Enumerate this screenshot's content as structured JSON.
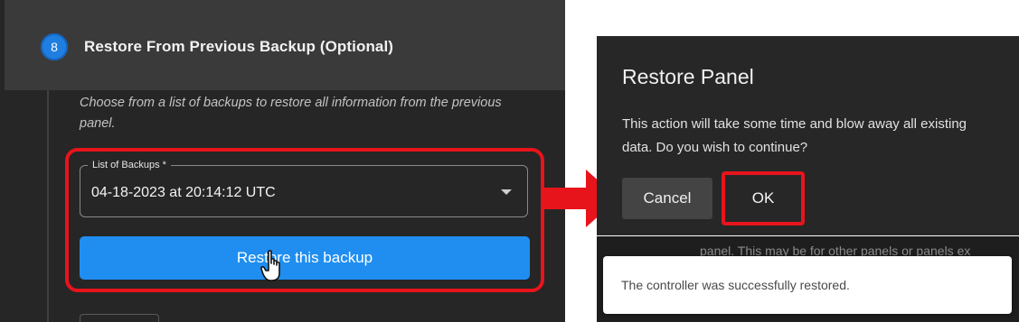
{
  "step": {
    "number": "8",
    "title": "Restore From Previous Backup (Optional)",
    "description": "Choose from a list of backups to restore all information from the previous panel."
  },
  "backup_select": {
    "label": "List of Backups *",
    "value": "04-18-2023 at 20:14:12 UTC"
  },
  "restore_button": {
    "label": "Restore this backup"
  },
  "dialog": {
    "title": "Restore Panel",
    "message": "This action will take some time and blow away all existing data. Do you wish to continue?",
    "cancel_label": "Cancel",
    "ok_label": "OK"
  },
  "background_text": "panel. This may be for other panels or panels ex",
  "toast": {
    "message": "The controller was successfully restored."
  },
  "colors": {
    "accent_blue": "#1f8ef0",
    "highlight_red": "#e8141c",
    "panel_dark": "#262626"
  },
  "icons": [
    "chevron-down-icon",
    "hand-pointer-icon",
    "right-arrow-icon"
  ]
}
